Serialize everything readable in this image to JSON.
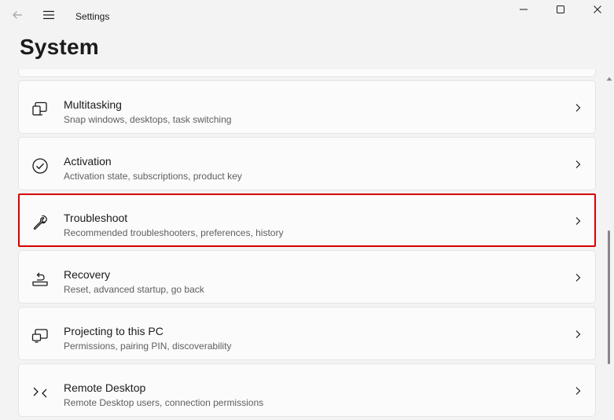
{
  "window": {
    "title": "Settings"
  },
  "page": {
    "title": "System"
  },
  "items": [
    {
      "icon": "multitasking-icon",
      "name": "Multitasking",
      "desc": "Snap windows, desktops, task switching"
    },
    {
      "icon": "activation-icon",
      "name": "Activation",
      "desc": "Activation state, subscriptions, product key"
    },
    {
      "icon": "wrench-icon",
      "name": "Troubleshoot",
      "desc": "Recommended troubleshooters, preferences, history"
    },
    {
      "icon": "recovery-icon",
      "name": "Recovery",
      "desc": "Reset, advanced startup, go back"
    },
    {
      "icon": "projecting-icon",
      "name": "Projecting to this PC",
      "desc": "Permissions, pairing PIN, discoverability"
    },
    {
      "icon": "remote-desktop-icon",
      "name": "Remote Desktop",
      "desc": "Remote Desktop users, connection permissions"
    }
  ],
  "colors": {
    "highlight_border": "#d60000",
    "background": "#f3f3f3",
    "card": "#fbfbfb"
  }
}
